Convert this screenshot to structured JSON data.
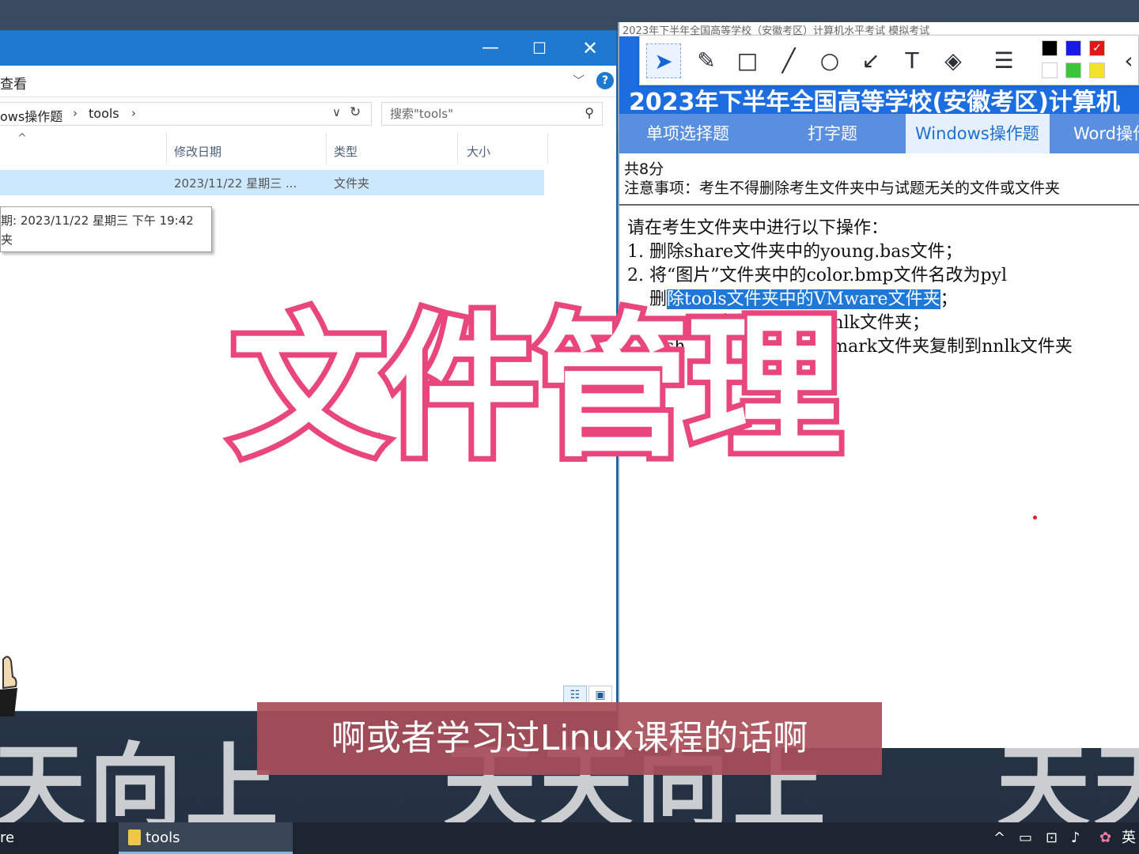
{
  "explorer": {
    "ribbon_tab": "查看",
    "crumbs": [
      "ows操作题",
      "tools"
    ],
    "search_placeholder": "搜索\"tools\"",
    "columns": [
      "修改日期",
      "类型",
      "大小"
    ],
    "row": {
      "date": "2023/11/22 星期三 ...",
      "type": "文件夹"
    },
    "tooltip": {
      "line1": "期: 2023/11/22 星期三 下午 19:42",
      "line2": "夹"
    }
  },
  "exam": {
    "window_title": "2023年下半年全国高等学校（安徽考区）计算机水平考试 模拟考试",
    "banner": "2023年下半年全国高等学校(安徽考区)计算机",
    "tabs": [
      "单项选择题",
      "打字题",
      "Windows操作题",
      "Word操作"
    ],
    "info": [
      "共8分",
      "注意事项：考生不得删除考生文件夹中与试题无关的文件或文件夹"
    ],
    "lines": {
      "l0": "请在考生文件夹中进行以下操作：",
      "l1": "1. 删除share文件夹中的young.bas文件；",
      "l2": "2. 将“图片”文件夹中的color.bmp文件名改为pyl",
      "l3a": "删",
      "l3b": "除tools文件夹中的VMware文件夹",
      "l3c": "；",
      "l4": "atan文件夹中新建nnlk文件夹；",
      "l5a": "sh",
      "l5b": "Jmark文件夹复制到nnlk文件夹"
    }
  },
  "overlay": {
    "title": "文件管理",
    "subtitle": "啊或者学习过Linux课程的话啊"
  },
  "taskbar": {
    "items": [
      "re",
      "tools"
    ],
    "ime": "英"
  },
  "colors": {
    "accent": "#1e7ad0",
    "title_stroke": "#e8467c",
    "subtitle_bg": "#a84e5a",
    "highlight": "#1e78d8"
  }
}
